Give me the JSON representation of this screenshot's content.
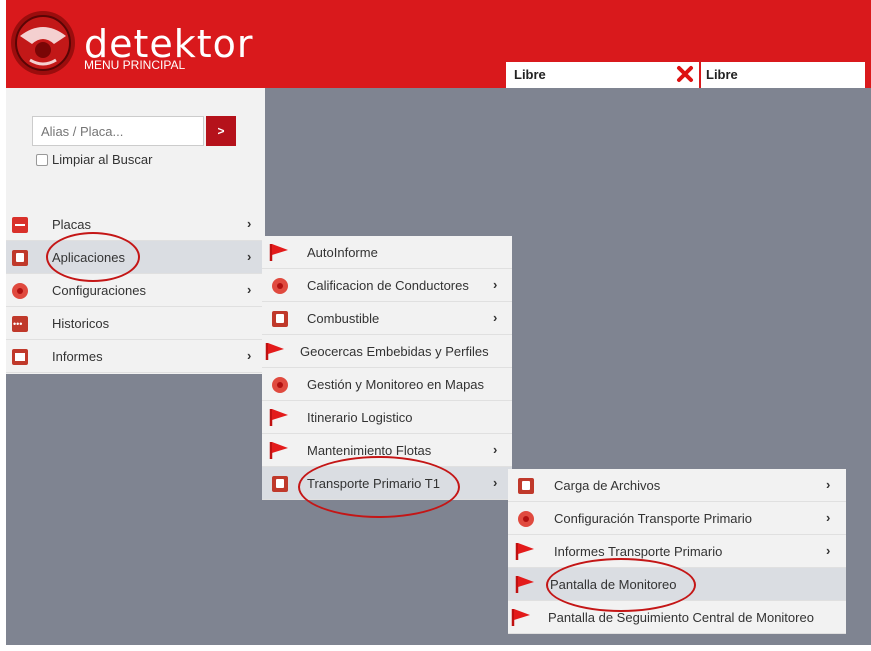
{
  "header": {
    "logo_text": "detektor",
    "subtitle": "MENU PRINCIPAL",
    "status_left": "Libre",
    "status_right": "Libre",
    "brand_color": "#d9191c"
  },
  "search": {
    "placeholder": "Alias / Placa...",
    "button_label": ">",
    "clear_label": "Limpiar al Buscar"
  },
  "main_menu": {
    "items": [
      {
        "label": "Placas",
        "icon": "card-icon",
        "arrow": "›"
      },
      {
        "label": "Aplicaciones",
        "icon": "box-icon",
        "arrow": "›"
      },
      {
        "label": "Configuraciones",
        "icon": "gear-icon",
        "arrow": "›"
      },
      {
        "label": "Historicos",
        "icon": "dots-icon",
        "arrow": ""
      },
      {
        "label": "Informes",
        "icon": "folder-icon",
        "arrow": "›"
      }
    ]
  },
  "apps_menu": {
    "items": [
      {
        "label": "AutoInforme",
        "icon": "flag-icon",
        "arrow": ""
      },
      {
        "label": "Calificacion de Conductores",
        "icon": "gear-icon",
        "arrow": "›"
      },
      {
        "label": "Combustible",
        "icon": "box-icon",
        "arrow": "›"
      },
      {
        "label": "Geocercas Embebidas y Perfiles",
        "icon": "flag-icon",
        "arrow": ""
      },
      {
        "label": "Gestión y Monitoreo en Mapas",
        "icon": "gear-icon",
        "arrow": ""
      },
      {
        "label": "Itinerario Logistico",
        "icon": "flag-icon",
        "arrow": ""
      },
      {
        "label": "Mantenimiento Flotas",
        "icon": "flag-icon",
        "arrow": "›"
      },
      {
        "label": "Transporte Primario T1",
        "icon": "box-icon",
        "arrow": "›"
      }
    ]
  },
  "tp_menu": {
    "items": [
      {
        "label": "Carga de Archivos",
        "icon": "box-icon",
        "arrow": "›"
      },
      {
        "label": "Configuración Transporte Primario",
        "icon": "gear-icon",
        "arrow": "›"
      },
      {
        "label": "Informes Transporte Primario",
        "icon": "flag-icon",
        "arrow": "›"
      },
      {
        "label": "Pantalla de Monitoreo",
        "icon": "flag-icon",
        "arrow": ""
      },
      {
        "label": "Pantalla de Seguimiento Central de Monitoreo",
        "icon": "flag-icon",
        "arrow": ""
      }
    ]
  }
}
